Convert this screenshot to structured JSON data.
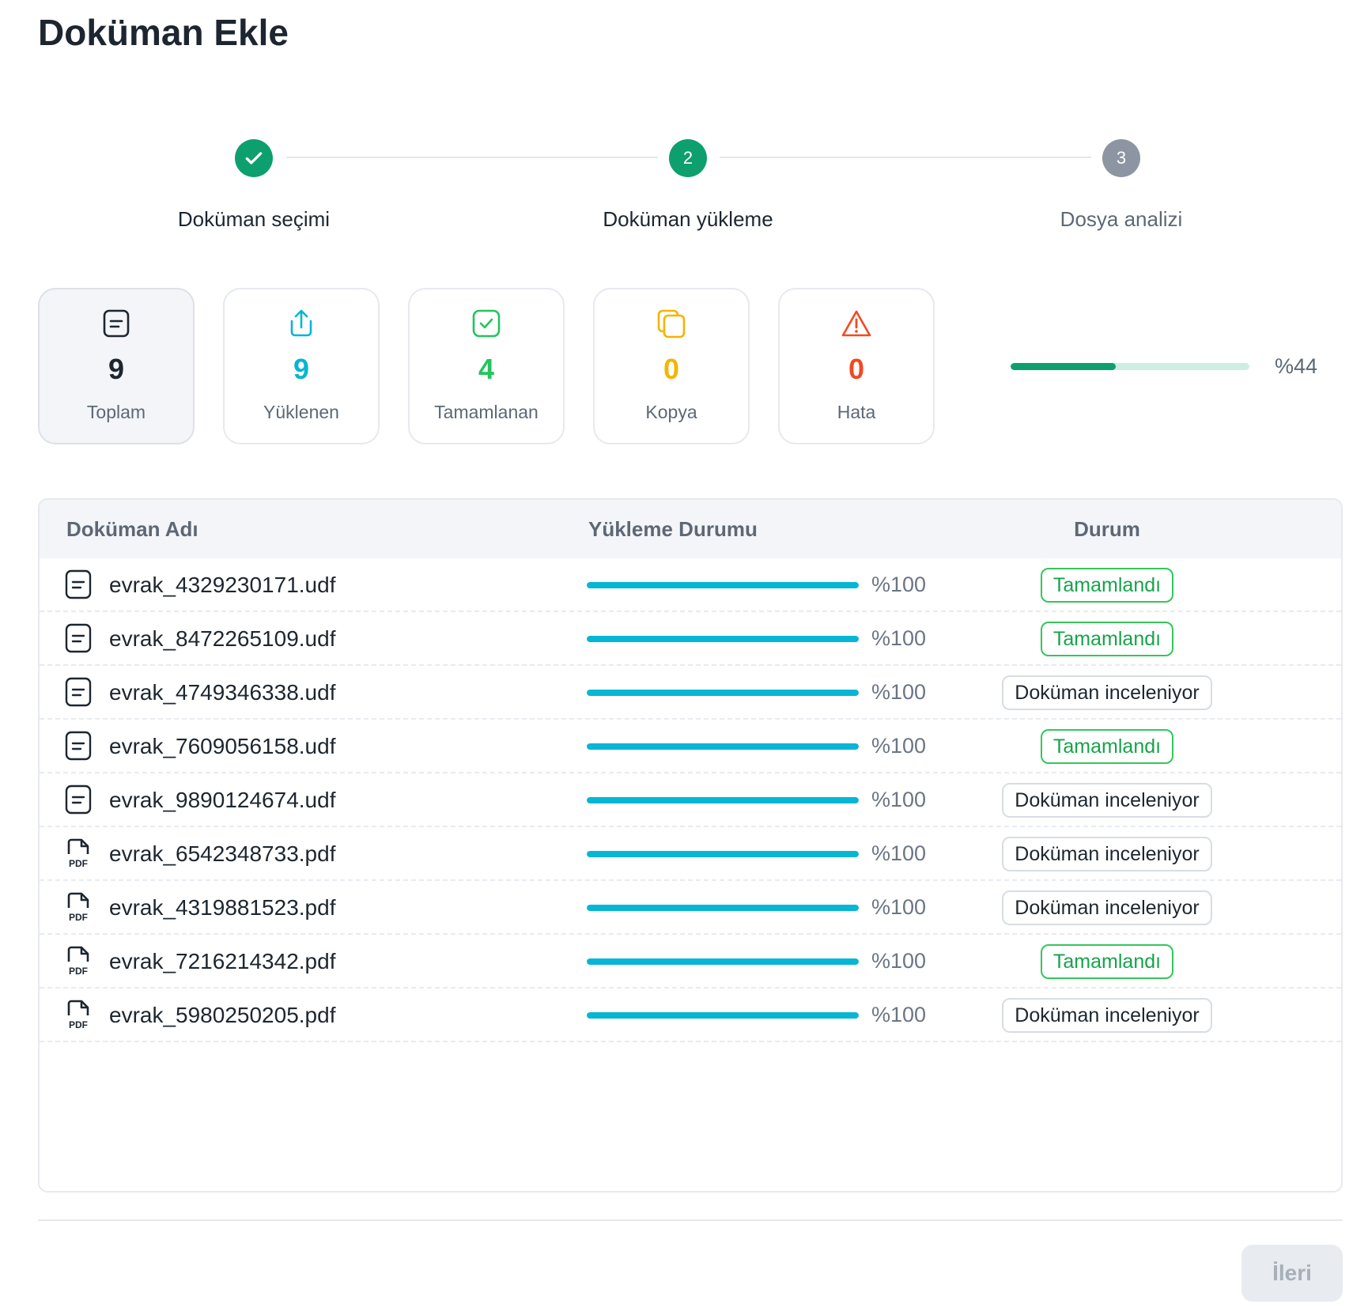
{
  "page": {
    "title": "Doküman Ekle"
  },
  "stepper": {
    "steps": [
      {
        "number": "",
        "label": "Doküman seçimi",
        "state": "done"
      },
      {
        "number": "2",
        "label": "Doküman yükleme",
        "state": "active"
      },
      {
        "number": "3",
        "label": "Dosya analizi",
        "state": "pending"
      }
    ]
  },
  "stats": [
    {
      "value": "9",
      "label": "Toplam",
      "icon": "document-icon",
      "color": "#1d2630"
    },
    {
      "value": "9",
      "label": "Yüklenen",
      "icon": "upload-icon",
      "color": "#06b6d4"
    },
    {
      "value": "4",
      "label": "Tamamlanan",
      "icon": "check-square-icon",
      "color": "#22c55e"
    },
    {
      "value": "0",
      "label": "Kopya",
      "icon": "copy-icon",
      "color": "#f5b400"
    },
    {
      "value": "0",
      "label": "Hata",
      "icon": "warning-icon",
      "color": "#f04a23"
    }
  ],
  "overall_progress": {
    "value": 44,
    "label": "%44"
  },
  "table": {
    "headers": {
      "name": "Doküman Adı",
      "upload": "Yükleme Durumu",
      "status": "Durum"
    },
    "rows": [
      {
        "name": "evrak_4329230171.udf",
        "type": "udf",
        "progress": 100,
        "progress_label": "%100",
        "status": "Tamamlandı",
        "status_type": "ok"
      },
      {
        "name": "evrak_8472265109.udf",
        "type": "udf",
        "progress": 100,
        "progress_label": "%100",
        "status": "Tamamlandı",
        "status_type": "ok"
      },
      {
        "name": "evrak_4749346338.udf",
        "type": "udf",
        "progress": 100,
        "progress_label": "%100",
        "status": "Doküman inceleniyor",
        "status_type": "pending"
      },
      {
        "name": "evrak_7609056158.udf",
        "type": "udf",
        "progress": 100,
        "progress_label": "%100",
        "status": "Tamamlandı",
        "status_type": "ok"
      },
      {
        "name": "evrak_9890124674.udf",
        "type": "udf",
        "progress": 100,
        "progress_label": "%100",
        "status": "Doküman inceleniyor",
        "status_type": "pending"
      },
      {
        "name": "evrak_6542348733.pdf",
        "type": "pdf",
        "progress": 100,
        "progress_label": "%100",
        "status": "Doküman inceleniyor",
        "status_type": "pending"
      },
      {
        "name": "evrak_4319881523.pdf",
        "type": "pdf",
        "progress": 100,
        "progress_label": "%100",
        "status": "Doküman inceleniyor",
        "status_type": "pending"
      },
      {
        "name": "evrak_7216214342.pdf",
        "type": "pdf",
        "progress": 100,
        "progress_label": "%100",
        "status": "Tamamlandı",
        "status_type": "ok"
      },
      {
        "name": "evrak_5980250205.pdf",
        "type": "pdf",
        "progress": 100,
        "progress_label": "%100",
        "status": "Doküman inceleniyor",
        "status_type": "pending"
      }
    ]
  },
  "footer": {
    "next_label": "İleri",
    "next_disabled": true
  }
}
